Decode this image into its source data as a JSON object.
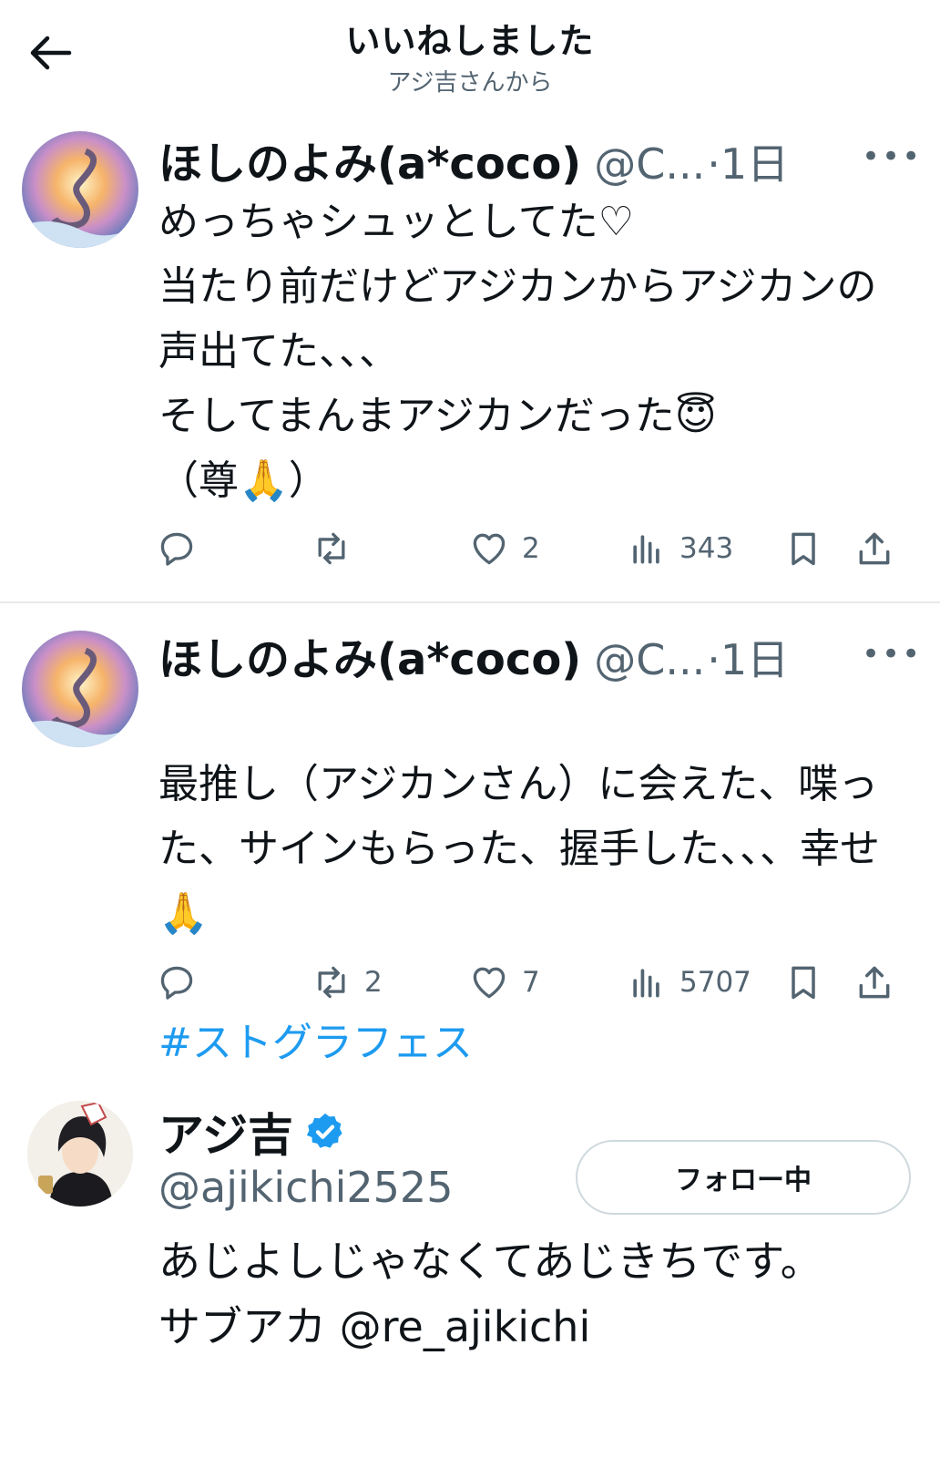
{
  "header": {
    "title": "いいねしました",
    "subtitle": "アジ吉さんから"
  },
  "tweets": [
    {
      "name": "ほしのよみ(a*coco)",
      "handle": "@C...",
      "time": "·1日",
      "text": "めっちゃシュッとしてた♡\n当たり前だけどアジカンからアジカンの声出てた、、、\nそしてまんまアジカンだった😇\n（尊🙏）",
      "hashtag": "",
      "replies": "",
      "retweets": "",
      "likes": "2",
      "views": "343"
    },
    {
      "name": "ほしのよみ(a*coco)",
      "handle": "@C...",
      "time": "·1日",
      "text": "最推し（アジカンさん）に会えた、喋った、サインもらった、握手した、、、幸せ🙏",
      "hashtag": "#ストグラフェス",
      "replies": "",
      "retweets": "2",
      "likes": "7",
      "views": "5707"
    }
  ],
  "user": {
    "name": "アジ吉",
    "handle": "@ajikichi2525",
    "follow_label": "フォロー中",
    "bio": "あじよしじゃなくてあじきちです。\nサブアカ @re_ajikichi"
  },
  "colors": {
    "link": "#1d9bf0",
    "secondary": "#536471",
    "verified": "#1d9bf0"
  }
}
